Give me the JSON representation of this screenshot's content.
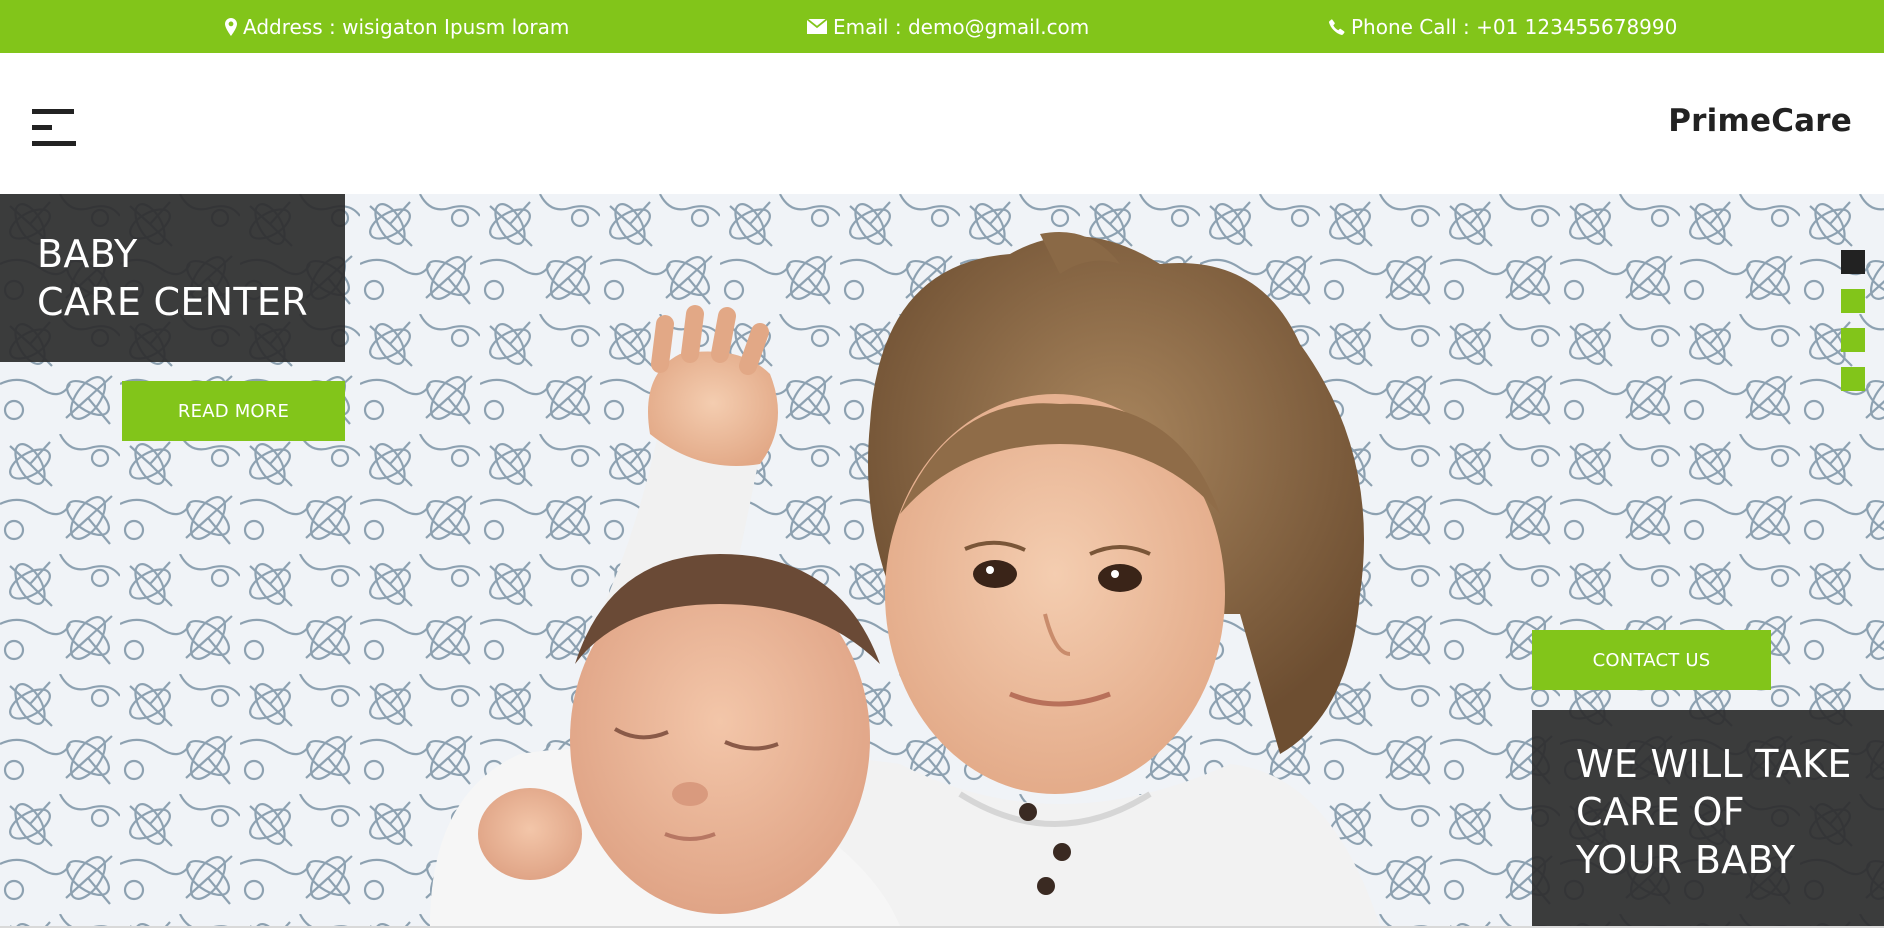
{
  "topbar": {
    "address": "Address : wisigaton Ipusm loram",
    "email": "Email : demo@gmail.com",
    "phone": "Phone Call : +01 123455678990",
    "icons": [
      "map-marker-icon",
      "envelope-icon",
      "phone-icon"
    ]
  },
  "header": {
    "brand": "PrimeCare",
    "menu_icon": "hamburger-menu-icon"
  },
  "hero": {
    "title_line1": "BABY",
    "title_line2": "CARE CENTER",
    "read_more_label": "READ MORE",
    "contact_label": "CONTACT US",
    "tagline_line1": "WE WILL TAKE",
    "tagline_line2": "CARE OF",
    "tagline_line3": "YOUR BABY",
    "slides_total": 4,
    "active_slide": 1
  },
  "colors": {
    "accent": "#82c51a",
    "dark": "#2d2d2d",
    "text_light": "#ffffff"
  }
}
